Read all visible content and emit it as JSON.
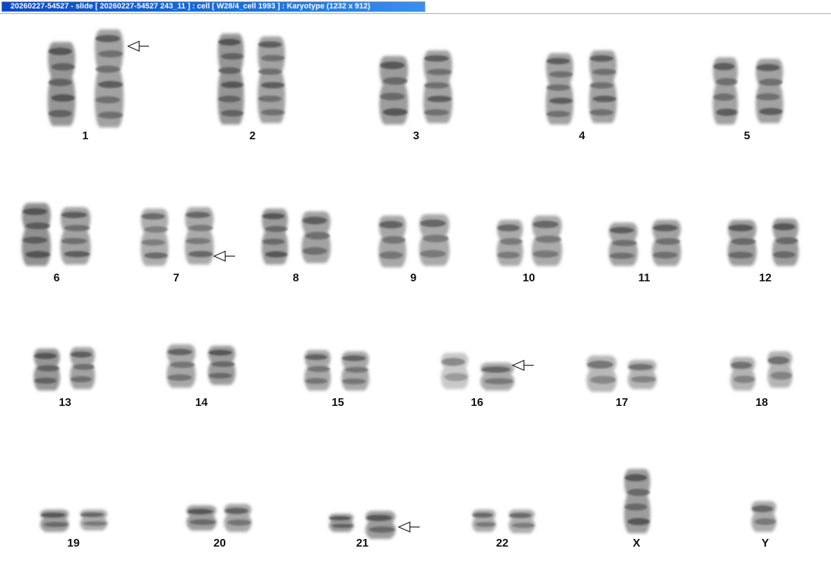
{
  "window": {
    "title": "20260227-54527 - slide [ 20260227-54527 243_11 ] : cell [ W28/4_cell 1993 ] : Karyotype  (1232 x 912)"
  },
  "karyotype": {
    "pairs": [
      "1",
      "2",
      "3",
      "4",
      "5",
      "6",
      "7",
      "8",
      "9",
      "10",
      "11",
      "12",
      "13",
      "14",
      "15",
      "16",
      "17",
      "18",
      "19",
      "20",
      "21",
      "22",
      "X",
      "Y"
    ],
    "arrow_icon": "left-arrow-icon",
    "flagged_pairs": [
      "1",
      "7",
      "16",
      "21"
    ]
  }
}
